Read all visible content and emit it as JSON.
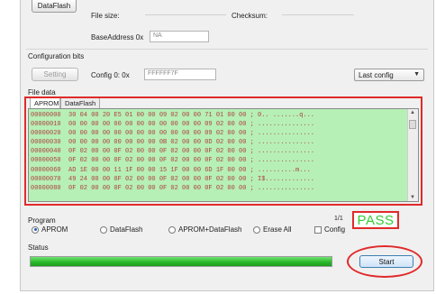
{
  "top": {
    "dataflash_button": "DataFlash",
    "file_size_label": "File size:",
    "checksum_label": "Checksum:",
    "base_address_label": "BaseAddress 0x",
    "base_address_value": "NA"
  },
  "config": {
    "section_label": "Configuration bits",
    "setting_button": "Setting",
    "config0_label": "Config 0: 0x",
    "config0_value": "FFFFFF7F",
    "last_config_label": "Last config"
  },
  "file_data": {
    "section_label": "File data",
    "tabs": [
      {
        "label": "APROM"
      },
      {
        "label": "DataFlash"
      }
    ],
    "rows": [
      "00000000  30 04 00 20 E5 01 00 00 09 02 00 00 71 01 00 00 ; 0.. .......q...",
      "00000010  00 00 00 00 00 00 00 00 00 00 00 00 09 02 00 00 ; ...............",
      "00000020  00 00 00 00 00 00 00 00 00 00 00 00 09 02 00 00 ; ...............",
      "00000030  00 00 00 00 00 00 00 00 0B 02 00 00 0D 02 00 00 ; ...............",
      "00000040  0F 02 00 00 0F 02 00 00 0F 02 00 00 0F 02 00 00 ; ...............",
      "00000050  0F 02 00 00 0F 02 00 00 0F 02 00 00 0F 02 00 00 ; ...............",
      "00000060  AD 1E 00 00 11 1F 00 00 15 1F 00 00 6D 1F 00 00 ; ..........m...",
      "00000070  49 24 00 00 0F 02 00 00 0F 02 00 00 0F 02 00 00 ; I$.............",
      "00000080  0F 02 00 00 0F 02 00 00 0F 02 00 00 0F 02 00 00 ; ..............."
    ]
  },
  "program": {
    "section_label": "Program",
    "options": [
      {
        "label": "APROM",
        "selected": true
      },
      {
        "label": "DataFlash",
        "selected": false
      },
      {
        "label": "APROM+DataFlash",
        "selected": false
      },
      {
        "label": "Erase All",
        "selected": false
      }
    ],
    "config_checkbox_label": "Config",
    "count": "1/1",
    "result": "PASS"
  },
  "status": {
    "section_label": "Status",
    "progress_percent": 100,
    "start_button": "Start"
  },
  "colors": {
    "hex_background": "#b6f0b6",
    "highlight_red": "#e02a2a",
    "pass_green": "#33cc33",
    "progress_green": "#27b527"
  }
}
